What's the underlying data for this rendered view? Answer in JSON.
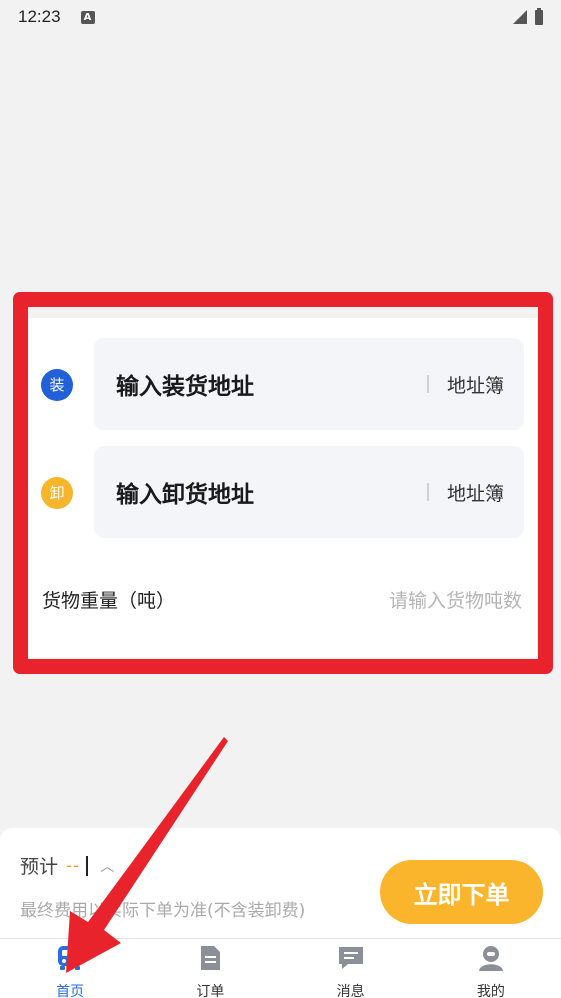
{
  "status_bar": {
    "time": "12:23",
    "notification_icon": "A"
  },
  "form": {
    "load": {
      "badge": "装",
      "placeholder": "输入装货地址",
      "address_book": "地址簿"
    },
    "unload": {
      "badge": "卸",
      "placeholder": "输入卸货地址",
      "address_book": "地址簿"
    },
    "weight": {
      "label": "货物重量（吨）",
      "placeholder": "请输入货物吨数"
    }
  },
  "bottom": {
    "estimate_label": "预计",
    "estimate_value": "--",
    "fee_note": "最终费用以实际下单为准(不含装卸费)",
    "order_button": "立即下单"
  },
  "tabs": [
    {
      "label": "首页",
      "icon": "truck-icon",
      "active": true
    },
    {
      "label": "订单",
      "icon": "document-icon",
      "active": false
    },
    {
      "label": "消息",
      "icon": "message-icon",
      "active": false
    },
    {
      "label": "我的",
      "icon": "person-icon",
      "active": false
    }
  ],
  "colors": {
    "highlight": "#e8232b",
    "load_badge": "#2160d6",
    "unload_badge": "#f7b52c",
    "order_button": "#fbb52c",
    "active_tab": "#2a6de0",
    "estimate_dash": "#f39a2b"
  }
}
